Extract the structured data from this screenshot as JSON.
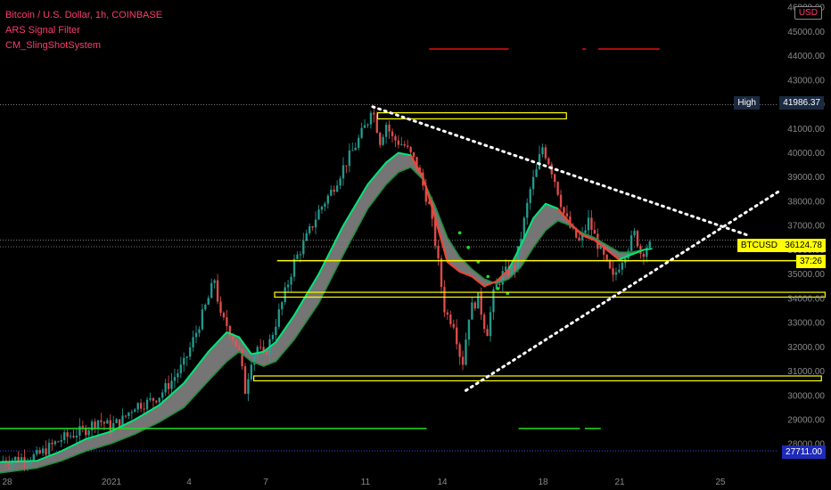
{
  "header": {
    "symbol_title": "Bitcoin / U.S. Dollar, 1h, COINBASE",
    "indicator_1": "ARS Signal Filter",
    "indicator_2": "CM_SlingShotSystem",
    "currency": "USD"
  },
  "price_tags": {
    "high_label": "High",
    "high_value": "41986.37",
    "last_label": "BTCUSD",
    "last_value": "36124.78",
    "countdown": "37:26",
    "low_value": "27711.00"
  },
  "colors": {
    "background": "#000000",
    "candle_up": "#26a69a",
    "candle_down": "#ef5350",
    "fast_ema": "#00e676",
    "slow_ema": "#ff3b30",
    "band_fill": "#8a8a8a",
    "channel": "#ffff00",
    "trendline": "#ffffff",
    "signal_red": "#e01010",
    "signal_green": "#22dd22"
  },
  "chart_data": {
    "type": "candlestick",
    "title": "Bitcoin / U.S. Dollar, 1h, COINBASE",
    "xlabel": "",
    "ylabel": "",
    "x_axis_ticks": [
      "28",
      "2021",
      "4",
      "7",
      "11",
      "14",
      "18",
      "21",
      "25"
    ],
    "y_axis_ticks": [
      46000,
      45000,
      44000,
      43000,
      42000,
      41000,
      40000,
      39000,
      38000,
      37000,
      36000,
      35000,
      34000,
      33000,
      32000,
      31000,
      30000,
      29000,
      28000
    ],
    "ylim": [
      27200,
      46300
    ],
    "price_path": [
      [
        0,
        27300
      ],
      [
        3,
        27500
      ],
      [
        5,
        28200
      ],
      [
        7,
        28600
      ],
      [
        8,
        29000
      ],
      [
        9,
        28700
      ],
      [
        10,
        29000
      ],
      [
        11,
        29600
      ],
      [
        12,
        29700
      ],
      [
        13,
        30000
      ],
      [
        14,
        30600
      ],
      [
        15,
        31300
      ],
      [
        16,
        32600
      ],
      [
        17,
        34000
      ],
      [
        17.5,
        34800
      ],
      [
        18,
        33200
      ],
      [
        18.5,
        32900
      ],
      [
        19,
        32400
      ],
      [
        19.5,
        31800
      ],
      [
        20,
        30200
      ],
      [
        20.5,
        31500
      ],
      [
        21,
        32000
      ],
      [
        21.5,
        31600
      ],
      [
        22,
        32200
      ],
      [
        23,
        33800
      ],
      [
        24,
        35500
      ],
      [
        25,
        36500
      ],
      [
        26,
        37600
      ],
      [
        27,
        38400
      ],
      [
        28,
        39400
      ],
      [
        29,
        40300
      ],
      [
        30,
        41300
      ],
      [
        30.3,
        41986
      ],
      [
        31,
        40500
      ],
      [
        31.5,
        41200
      ],
      [
        32,
        40600
      ],
      [
        33,
        40300
      ],
      [
        34,
        39500
      ],
      [
        35,
        37800
      ],
      [
        35.6,
        36000
      ],
      [
        36.3,
        33400
      ],
      [
        37,
        33000
      ],
      [
        37.7,
        31200
      ],
      [
        38.3,
        33500
      ],
      [
        39,
        34000
      ],
      [
        39.7,
        32500
      ],
      [
        40.3,
        34300
      ],
      [
        41,
        35000
      ],
      [
        42,
        35300
      ],
      [
        42.6,
        36800
      ],
      [
        43.3,
        38600
      ],
      [
        43.8,
        39300
      ],
      [
        44.2,
        40300
      ],
      [
        44.8,
        39600
      ],
      [
        45.3,
        38800
      ],
      [
        46,
        37500
      ],
      [
        46.6,
        36800
      ],
      [
        47.3,
        36300
      ],
      [
        48,
        37200
      ],
      [
        48.7,
        36300
      ],
      [
        49.3,
        35600
      ],
      [
        50,
        34800
      ],
      [
        50.6,
        35500
      ],
      [
        51.2,
        36100
      ],
      [
        51.8,
        36700
      ],
      [
        52.3,
        35800
      ],
      [
        52.8,
        36200
      ],
      [
        53.2,
        36100
      ]
    ],
    "fast_ema": [
      [
        0,
        27250
      ],
      [
        3,
        27300
      ],
      [
        5,
        27700
      ],
      [
        7,
        28200
      ],
      [
        9,
        28500
      ],
      [
        11,
        29000
      ],
      [
        13,
        29600
      ],
      [
        15,
        30500
      ],
      [
        17,
        31800
      ],
      [
        18.5,
        32600
      ],
      [
        19.5,
        32400
      ],
      [
        20.5,
        31700
      ],
      [
        21.5,
        31800
      ],
      [
        22.5,
        32200
      ],
      [
        24,
        33300
      ],
      [
        26,
        35000
      ],
      [
        28,
        37000
      ],
      [
        30,
        38700
      ],
      [
        31.5,
        39600
      ],
      [
        32.5,
        40000
      ],
      [
        33.5,
        39900
      ],
      [
        34.5,
        39000
      ],
      [
        35.5,
        37300
      ],
      [
        36.5,
        35500
      ],
      [
        37.5,
        35100
      ],
      [
        38.5,
        34900
      ],
      [
        39.5,
        34500
      ],
      [
        40.5,
        34700
      ],
      [
        41.5,
        35200
      ],
      [
        42.5,
        36200
      ],
      [
        43.5,
        37300
      ],
      [
        44.5,
        37900
      ],
      [
        45.5,
        37700
      ],
      [
        46.5,
        37100
      ],
      [
        47.5,
        36600
      ],
      [
        48.5,
        36400
      ],
      [
        49.5,
        36000
      ],
      [
        50.5,
        35600
      ],
      [
        51.5,
        35800
      ],
      [
        52.5,
        36000
      ],
      [
        53.2,
        36050
      ]
    ],
    "slow_ema": [
      [
        0,
        26800
      ],
      [
        3,
        27000
      ],
      [
        5,
        27300
      ],
      [
        7,
        27700
      ],
      [
        9,
        28000
      ],
      [
        11,
        28400
      ],
      [
        13,
        28900
      ],
      [
        15,
        29500
      ],
      [
        17,
        30600
      ],
      [
        18.5,
        31400
      ],
      [
        19.5,
        31800
      ],
      [
        20.5,
        31400
      ],
      [
        21.5,
        31200
      ],
      [
        22.5,
        31400
      ],
      [
        24,
        32300
      ],
      [
        26,
        33800
      ],
      [
        28,
        35800
      ],
      [
        30,
        37700
      ],
      [
        31.5,
        38700
      ],
      [
        32.5,
        39200
      ],
      [
        33.5,
        39400
      ],
      [
        34.5,
        38900
      ],
      [
        35.5,
        37800
      ],
      [
        36.5,
        36500
      ],
      [
        37.5,
        35700
      ],
      [
        38.5,
        35200
      ],
      [
        39.5,
        34800
      ],
      [
        40.5,
        34600
      ],
      [
        41.5,
        34800
      ],
      [
        42.5,
        35300
      ],
      [
        43.5,
        36100
      ],
      [
        44.5,
        36800
      ],
      [
        45.5,
        37200
      ],
      [
        46.5,
        37000
      ],
      [
        47.5,
        36700
      ],
      [
        48.5,
        36500
      ],
      [
        49.5,
        36200
      ],
      [
        50.5,
        35900
      ],
      [
        51.5,
        35900
      ],
      [
        52.5,
        36000
      ],
      [
        53.2,
        36050
      ]
    ],
    "resistance_line": [
      [
        30.4,
        41900
      ],
      [
        61,
        36600
      ]
    ],
    "support_line": [
      [
        38,
        30200
      ],
      [
        63.5,
        38400
      ]
    ],
    "horizontal_boxes": [
      {
        "x0": 30.8,
        "x1": 46.2,
        "y0": 41400,
        "y1": 41650
      },
      {
        "x0": 22.4,
        "x1": 67.3,
        "y0": 34050,
        "y1": 34250
      },
      {
        "x0": 20.7,
        "x1": 67.0,
        "y0": 30600,
        "y1": 30800
      }
    ],
    "horizontal_lines": [
      {
        "x0": 22.6,
        "x1": 65.1,
        "y": 35550
      }
    ],
    "dotted_levels": [
      41986,
      36400,
      36124,
      27711
    ],
    "red_signals": [
      [
        35,
        41.5
      ],
      [
        47.5,
        47.8
      ],
      [
        48.8,
        53.8
      ]
    ],
    "green_signals": [
      [
        0,
        34.8
      ],
      [
        42.3,
        47.3
      ],
      [
        47.7,
        49
      ]
    ],
    "green_markers": [
      [
        37.5,
        36700
      ],
      [
        38.2,
        36100
      ],
      [
        39,
        35500
      ],
      [
        39.8,
        34900
      ],
      [
        40.6,
        34400
      ],
      [
        41.4,
        34200
      ]
    ]
  }
}
